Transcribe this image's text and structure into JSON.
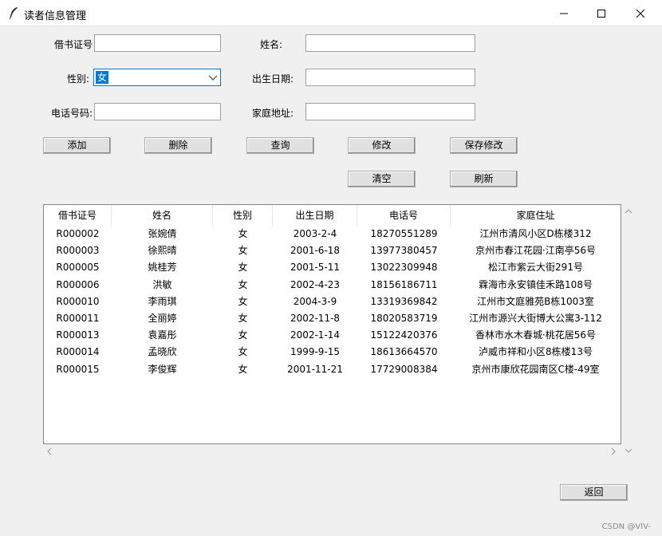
{
  "window": {
    "title": "读者信息管理",
    "minimize_glyph": "minimize-icon",
    "maximize_glyph": "maximize-icon",
    "close_glyph": "close-icon"
  },
  "form": {
    "card_label": "借书证号",
    "card_value": "",
    "name_label": "姓名:",
    "name_value": "",
    "gender_label": "性别:",
    "gender_value": "女",
    "birth_label": "出生日期:",
    "birth_value": "",
    "phone_label": "电话号码:",
    "phone_value": "",
    "address_label": "家庭地址:",
    "address_value": ""
  },
  "buttons": {
    "add": "添加",
    "delete": "删除",
    "query": "查询",
    "modify": "修改",
    "save": "保存修改",
    "clear": "清空",
    "refresh": "刷新",
    "back": "返回"
  },
  "table": {
    "headers": [
      "借书证号",
      "姓名",
      "性别",
      "出生日期",
      "电话号",
      "家庭住址"
    ],
    "rows": [
      [
        "R000002",
        "张婉倩",
        "女",
        "2003-2-4",
        "18270551289",
        "江州市清风小区D栋楼312"
      ],
      [
        "R000003",
        "徐熙晴",
        "女",
        "2001-6-18",
        "13977380457",
        "京州市春江花园·江南亭56号"
      ],
      [
        "R000005",
        "姚桂芳",
        "女",
        "2001-5-11",
        "13022309948",
        "松江市紫云大街291号"
      ],
      [
        "R000006",
        "洪敏",
        "女",
        "2002-4-23",
        "18156186711",
        "霖海市永安镇佳禾路108号"
      ],
      [
        "R000010",
        "李雨琪",
        "女",
        "2004-3-9",
        "13319369842",
        "江州市文庭雅苑B栋1003室"
      ],
      [
        "R000011",
        "全丽婷",
        "女",
        "2002-11-8",
        "18020583719",
        "江州市源兴大街博大公寓3-112"
      ],
      [
        "R000013",
        "袁嘉彤",
        "女",
        "2002-1-14",
        "15122420376",
        "香林市水木春城·桃花居56号"
      ],
      [
        "R000014",
        "孟晓欣",
        "女",
        "1999-9-15",
        "18613664570",
        "泸威市祥和小区8栋楼13号"
      ],
      [
        "R000015",
        "李俊辉",
        "女",
        "2001-11-21",
        "17729008384",
        "京州市康欣花园南区C楼-49室"
      ]
    ]
  },
  "watermark": "CSDN @VIV-"
}
